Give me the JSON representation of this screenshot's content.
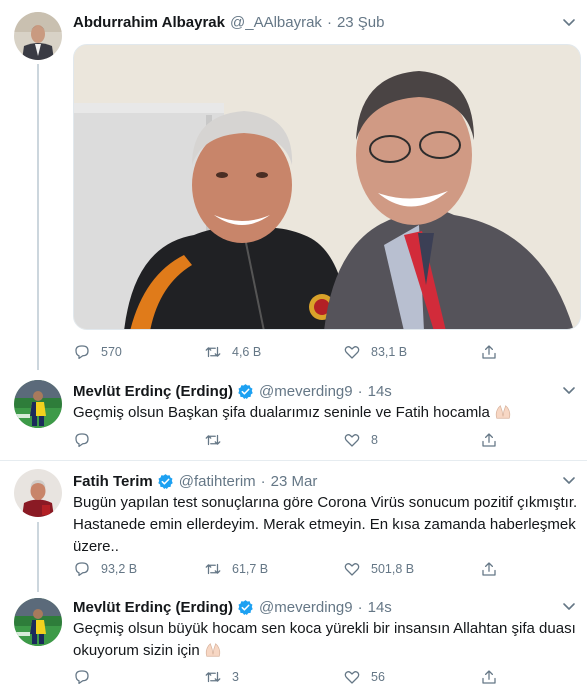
{
  "tweets": [
    {
      "name": "Abdurrahim Albayrak",
      "handle": "@_AAlbayrak",
      "time": "23 Şub",
      "verified": false,
      "text": "",
      "reply_count": "570",
      "retweet_count": "4,6 B",
      "like_count": "83,1 B"
    },
    {
      "name": "Mevlüt Erdinç (Erding)",
      "handle": "@meverding9",
      "time": "14s",
      "verified": true,
      "text": "Geçmiş olsun Başkan şifa dualarımız seninle ve Fatih hocamla",
      "reply_count": "",
      "retweet_count": "",
      "like_count": "8"
    },
    {
      "name": "Fatih Terim",
      "handle": "@fatihterim",
      "time": "23 Mar",
      "verified": true,
      "text": "Bugün yapılan test sonuçlarına göre Corona Virüs sonucum pozitif çıkmıştır. Hastanede emin ellerdeyim. Merak etmeyin. En kısa zamanda haberleşmek üzere..",
      "reply_count": "93,2 B",
      "retweet_count": "61,7 B",
      "like_count": "501,8 B"
    },
    {
      "name": "Mevlüt Erdinç (Erding)",
      "handle": "@meverding9",
      "time": "14s",
      "verified": true,
      "text": "Geçmiş olsun büyük hocam sen koca yürekli bir insansın Allahtan şifa duası okuyorum sizin için",
      "reply_count": "",
      "retweet_count": "3",
      "like_count": "56"
    }
  ],
  "separator": "·",
  "colors": {
    "text": "#14171a",
    "muted": "#657786",
    "verified": "#1da1f2",
    "border": "#e6ecf0",
    "thread_line": "#ccd6dd"
  }
}
